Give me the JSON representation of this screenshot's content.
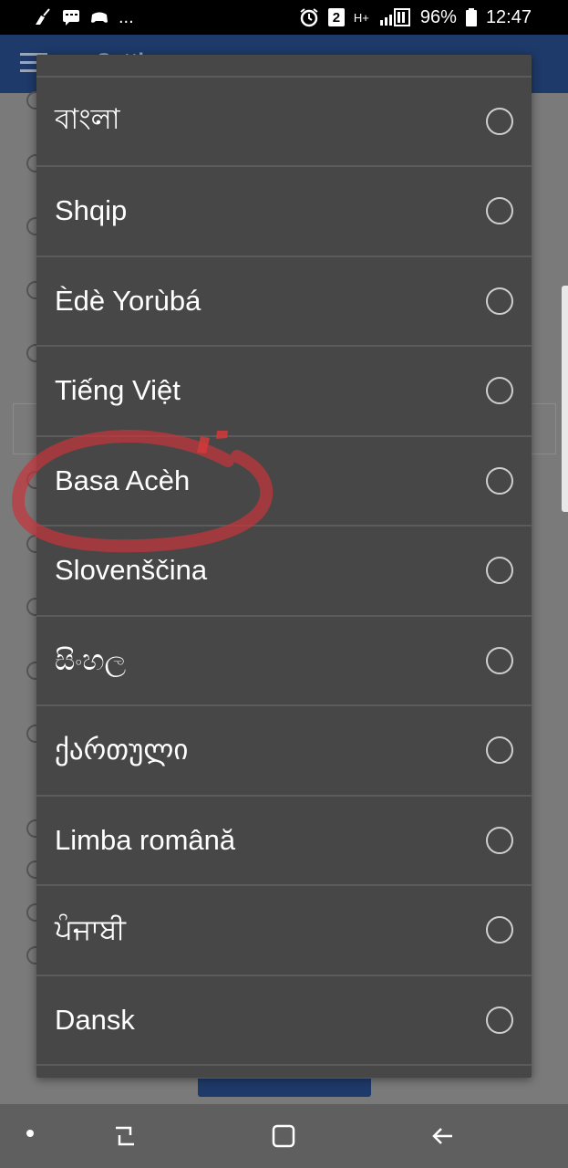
{
  "status_bar": {
    "notification_icons": [
      "sweep-icon",
      "chat-icon",
      "gamepad-icon"
    ],
    "overflow": "...",
    "alarm_icon": "alarm-icon",
    "badge": "2",
    "network_type": "H+",
    "battery_percent": "96%",
    "time": "12:47"
  },
  "dialog": {
    "options": [
      {
        "label": "বাংলা",
        "selected": false
      },
      {
        "label": "Shqip",
        "selected": false
      },
      {
        "label": "Èdè Yorùbá",
        "selected": false
      },
      {
        "label": "Tiếng Việt",
        "selected": false
      },
      {
        "label": "Basa Acèh",
        "selected": false
      },
      {
        "label": "Slovenščina",
        "selected": false
      },
      {
        "label": "සිංහල",
        "selected": false
      },
      {
        "label": "ქართული",
        "selected": false
      },
      {
        "label": "Limba română",
        "selected": false
      },
      {
        "label": "ਪੰਜਾਬੀ",
        "selected": false
      },
      {
        "label": "Dansk",
        "selected": false
      }
    ]
  },
  "annotation": {
    "color": "#c8343a",
    "target": "Basa Acèh"
  },
  "nav_bar": {
    "buttons": [
      "recents-icon",
      "home-icon",
      "back-icon"
    ]
  },
  "colors": {
    "dialog_bg": "#474747",
    "app_bar": "#1e3a6a",
    "scrim": "#7a7a7a"
  }
}
